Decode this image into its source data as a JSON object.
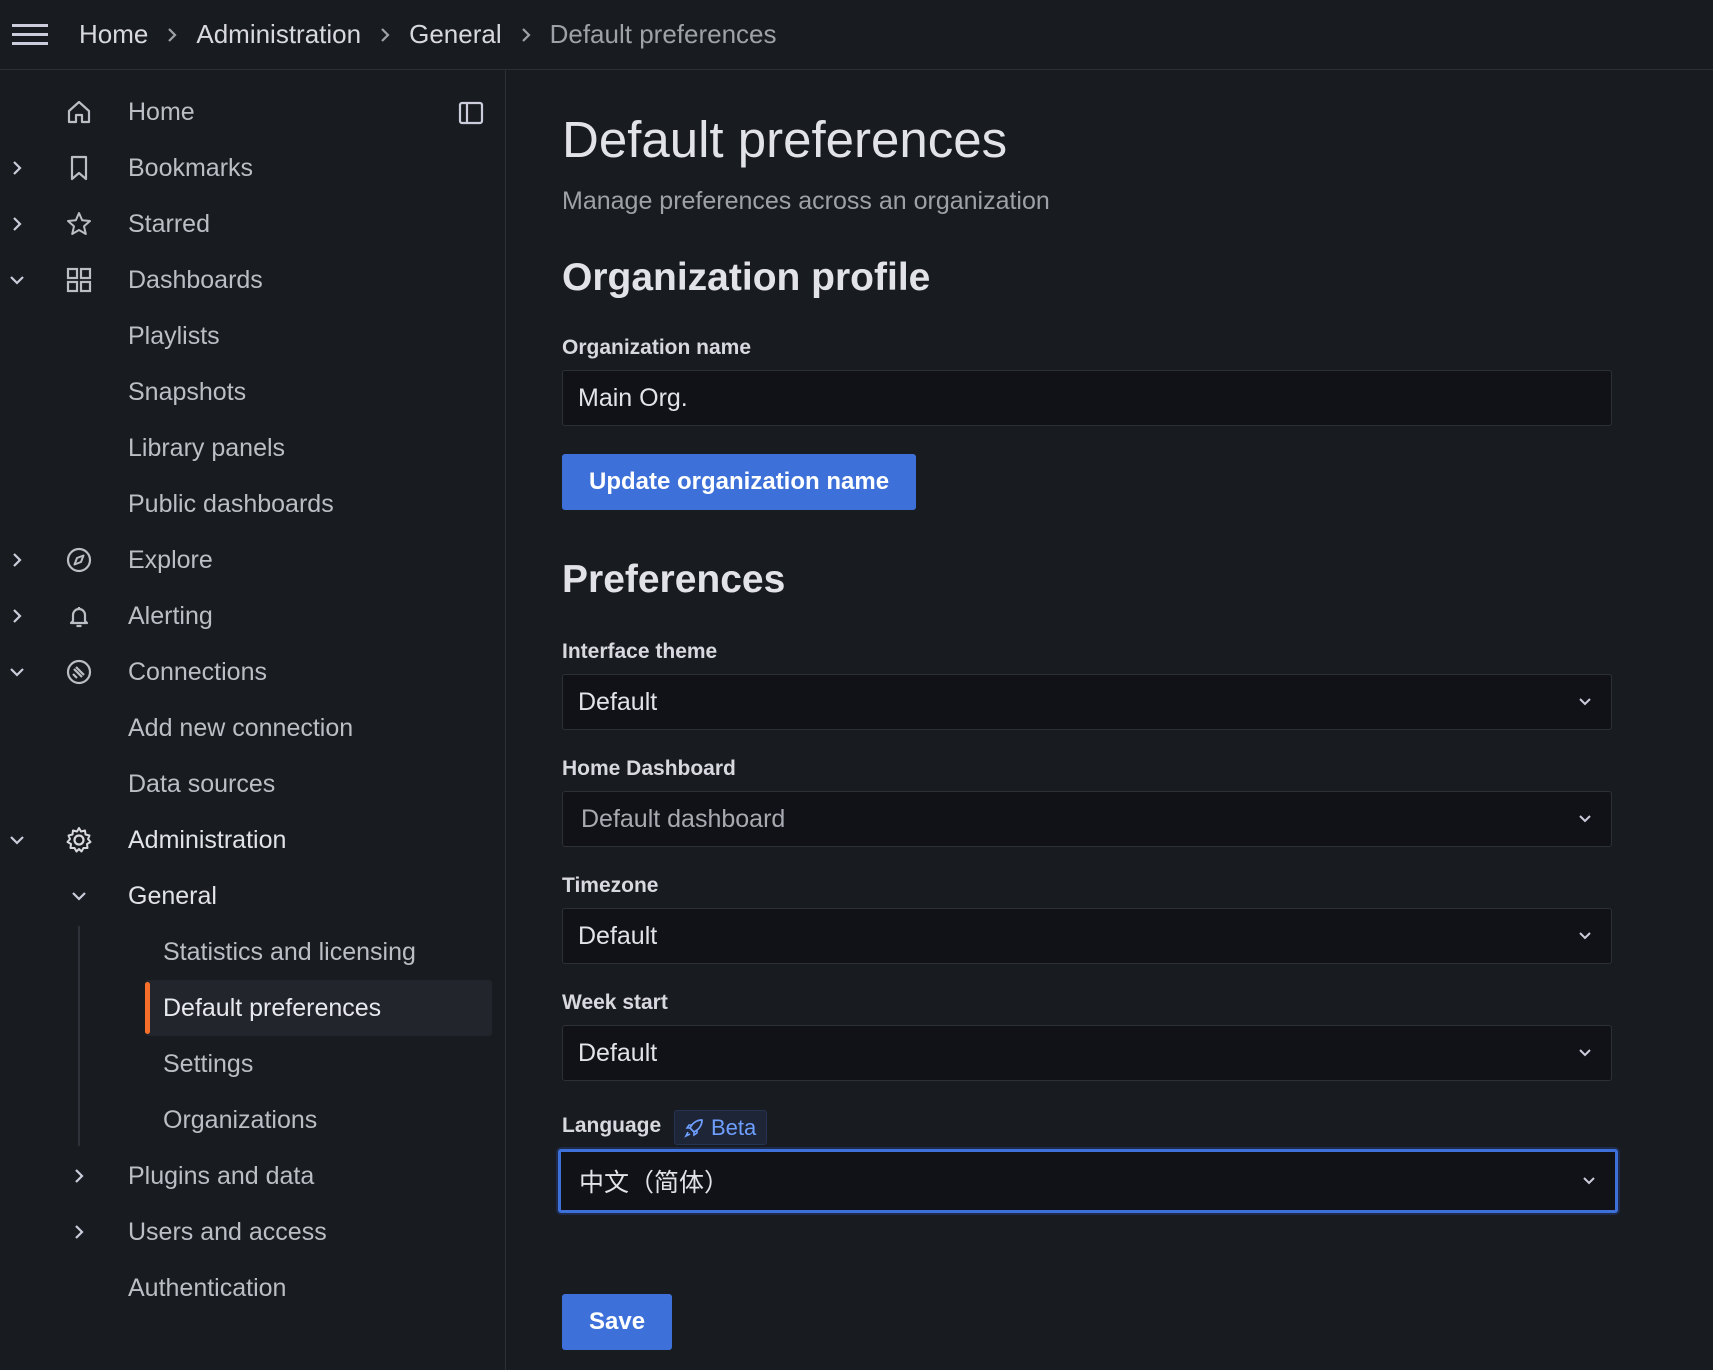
{
  "breadcrumb": {
    "items": [
      "Home",
      "Administration",
      "General"
    ],
    "current": "Default preferences"
  },
  "sidebar": {
    "items": {
      "home": "Home",
      "bookmarks": "Bookmarks",
      "starred": "Starred",
      "dashboards": "Dashboards",
      "playlists": "Playlists",
      "snapshots": "Snapshots",
      "library_panels": "Library panels",
      "public_dashboards": "Public dashboards",
      "explore": "Explore",
      "alerting": "Alerting",
      "connections": "Connections",
      "add_new_connection": "Add new connection",
      "data_sources": "Data sources",
      "administration": "Administration",
      "general": "General",
      "statistics_and_licensing": "Statistics and licensing",
      "default_preferences": "Default preferences",
      "settings": "Settings",
      "organizations": "Organizations",
      "plugins_and_data": "Plugins and data",
      "users_and_access": "Users and access",
      "authentication": "Authentication"
    },
    "active_item": "Default preferences",
    "active_color": "#f56f2b"
  },
  "page": {
    "title": "Default preferences",
    "subtitle": "Manage preferences across an organization"
  },
  "org_profile": {
    "heading": "Organization profile",
    "name_label": "Organization name",
    "name_value": "Main Org.",
    "update_button": "Update organization name"
  },
  "preferences": {
    "heading": "Preferences",
    "interface_theme": {
      "label": "Interface theme",
      "value": "Default"
    },
    "home_dashboard": {
      "label": "Home Dashboard",
      "placeholder": "Default dashboard"
    },
    "timezone": {
      "label": "Timezone",
      "value": "Default"
    },
    "week_start": {
      "label": "Week start",
      "value": "Default"
    },
    "language": {
      "label": "Language",
      "badge": "Beta",
      "value": "中文（简体）"
    },
    "save_button": "Save"
  },
  "colors": {
    "primary": "#3d71d9",
    "background": "#181b1f",
    "input_background": "#111217",
    "beta_text": "#6e9fff"
  },
  "icons": [
    "menu-icon",
    "home-icon",
    "bookmark-icon",
    "star-icon",
    "apps-icon",
    "compass-icon",
    "bell-icon",
    "plug-icon",
    "cog-icon",
    "dock-icon",
    "chevron-down-icon",
    "chevron-right-icon",
    "rocket-icon"
  ]
}
